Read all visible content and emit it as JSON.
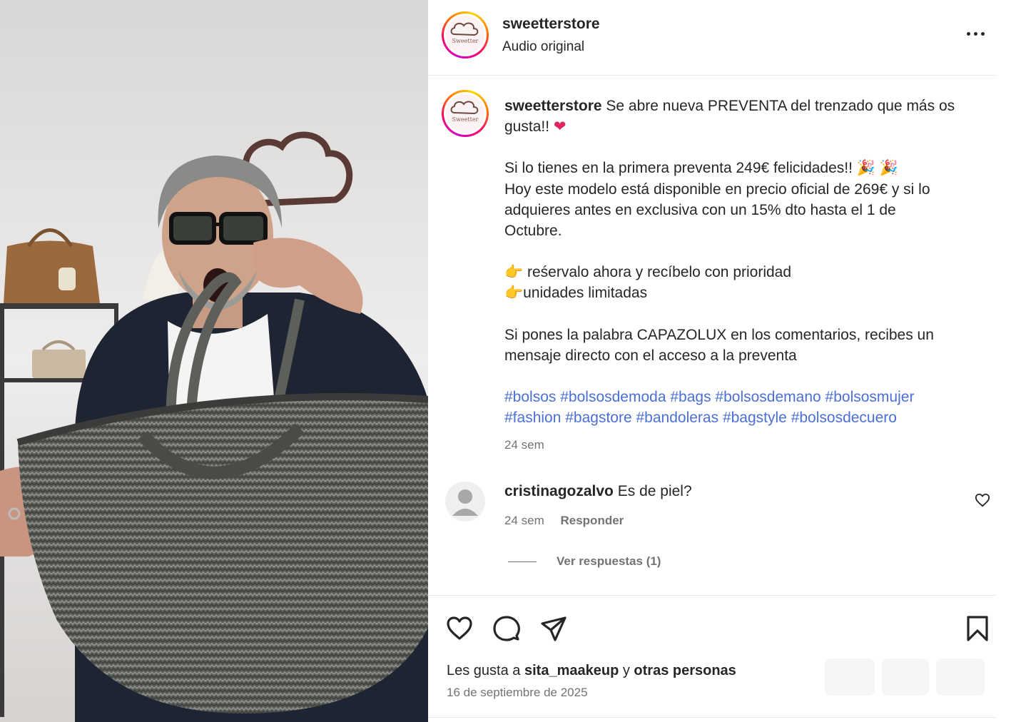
{
  "header": {
    "username": "sweetterstore",
    "audio": "Audio original"
  },
  "logo_text": "Sweetter",
  "caption": {
    "username": "sweetterstore",
    "lines": [
      "Se abre nueva PREVENTA del trenzado que más os",
      "gusta!!",
      "Si lo tienes en la primera preventa 249€ felicidades!!",
      "Hoy este modelo está disponible en precio oficial de 269€ y si lo",
      "adquieres antes en exclusiva con un 15% dto hasta el 1 de",
      "Octubre.",
      "reśervalo ahora y recíbelo con prioridad",
      "unidades limitadas",
      "Si pones la palabra CAPAZOLUX en los comentarios, recibes un",
      "mensaje directo con el acceso a la preventa"
    ],
    "emoji": {
      "heart": "❤",
      "party": "🎉",
      "point": "👉"
    },
    "hashtags_line1": [
      "#bolsos",
      "#bolsosdemoda",
      "#bags",
      "#bolsosdemano",
      "#bolsosmujer"
    ],
    "hashtags_line2": [
      "#fashion",
      "#bagstore",
      "#bandoleras",
      "#bagstyle",
      "#bolsosdecuero"
    ],
    "time": "24 sem"
  },
  "comment": {
    "username": "cristinagozalvo",
    "text": "Es de piel?",
    "time": "24 sem",
    "reply_label": "Responder",
    "view_replies": "Ver respuestas (1)"
  },
  "actions": {
    "likes_prefix": "Les gusta a",
    "likes_user": "sita_maakeup",
    "likes_mid": "y",
    "likes_others": "otras personas",
    "date": "16 de septiembre de 2025"
  },
  "icons": {
    "like": "heart-outline-icon",
    "comment": "speech-bubble-icon",
    "share": "paper-plane-icon",
    "save": "bookmark-icon",
    "more": "ellipsis-icon"
  },
  "colors": {
    "hashtag": "#00376b",
    "muted": "#737373",
    "text": "#262626",
    "border": "#e6e6e6"
  }
}
